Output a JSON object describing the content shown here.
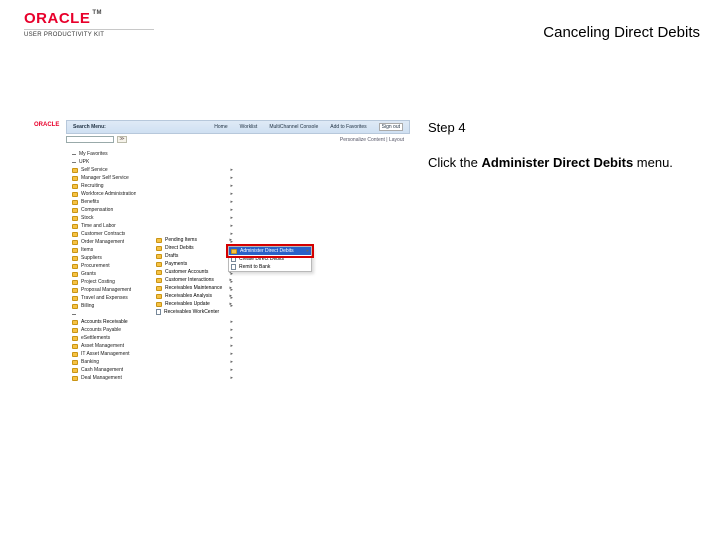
{
  "header": {
    "brand": "ORACLE",
    "brand_sub": "USER PRODUCTIVITY KIT",
    "tm": "TM",
    "topic_title": "Canceling Direct Debits"
  },
  "instructions": {
    "step_label": "Step 4",
    "line1": "Click the ",
    "bold_segment": "Administer Direct Debits",
    "line2": " menu."
  },
  "app": {
    "logo": "ORACLE",
    "search_label": "Search Menu:",
    "nav": [
      "Home",
      "Worklist",
      "MultiChannel Console",
      "Add to Favorites"
    ],
    "signout": "Sign out",
    "personalize": "Personalize Content | Layout"
  },
  "tree_left": [
    {
      "label": "My Favorites",
      "icon": "dash"
    },
    {
      "label": "UPK",
      "icon": "dash"
    },
    {
      "label": "Self Service",
      "icon": "folder",
      "arrow": true
    },
    {
      "label": "Manager Self Service",
      "icon": "folder",
      "arrow": true
    },
    {
      "label": "Recruiting",
      "icon": "folder",
      "arrow": true
    },
    {
      "label": "Workforce Administration",
      "icon": "folder",
      "arrow": true
    },
    {
      "label": "Benefits",
      "icon": "folder",
      "arrow": true
    },
    {
      "label": "Compensation",
      "icon": "folder",
      "arrow": true
    },
    {
      "label": "Stock",
      "icon": "folder",
      "arrow": true
    },
    {
      "label": "Time and Labor",
      "icon": "folder",
      "arrow": true
    },
    {
      "label": "Customer Contracts",
      "icon": "folder",
      "arrow": true
    },
    {
      "label": "Order Management",
      "icon": "folder",
      "arrow": true
    },
    {
      "label": "Items",
      "icon": "folder"
    },
    {
      "label": "Suppliers",
      "icon": "folder",
      "arrow": true
    },
    {
      "label": "Procurement",
      "icon": "folder",
      "arrow": true
    },
    {
      "label": "Grants",
      "icon": "folder",
      "arrow": true
    },
    {
      "label": "Project Costing",
      "icon": "folder",
      "arrow": true
    },
    {
      "label": "Proposal Management",
      "icon": "folder",
      "arrow": true
    },
    {
      "label": "Travel and Expenses",
      "icon": "folder",
      "arrow": true
    },
    {
      "label": "Billing",
      "icon": "folder",
      "arrow": true
    },
    {
      "label": "",
      "icon": "dash"
    },
    {
      "label": "Accounts Receivable",
      "icon": "folder",
      "arrow": true,
      "highlight": true
    },
    {
      "label": "Accounts Payable",
      "icon": "folder",
      "arrow": true
    },
    {
      "label": "eSettlements",
      "icon": "folder",
      "arrow": true
    },
    {
      "label": "Asset Management",
      "icon": "folder",
      "arrow": true
    },
    {
      "label": "IT Asset Management",
      "icon": "folder",
      "arrow": true
    },
    {
      "label": "Banking",
      "icon": "folder",
      "arrow": true
    },
    {
      "label": "Cash Management",
      "icon": "folder",
      "arrow": true
    },
    {
      "label": "Deal Management",
      "icon": "folder",
      "arrow": true
    }
  ],
  "tree_col2": [
    {
      "label": "Pending Items",
      "icon": "folder",
      "arrow": true
    },
    {
      "label": "Direct Debits",
      "icon": "folder",
      "arrow": true
    },
    {
      "label": "Drafts",
      "icon": "folder",
      "arrow": true
    },
    {
      "label": "Payments",
      "icon": "folder",
      "arrow": true
    },
    {
      "label": "Customer Accounts",
      "icon": "folder",
      "arrow": true
    },
    {
      "label": "Customer Interactions",
      "icon": "folder",
      "arrow": true
    },
    {
      "label": "Receivables Maintenance",
      "icon": "folder",
      "arrow": true
    },
    {
      "label": "Receivables Analysis",
      "icon": "folder",
      "arrow": true
    },
    {
      "label": "Receivables Update",
      "icon": "folder",
      "arrow": true
    },
    {
      "label": "Receivables WorkCenter",
      "icon": "page"
    }
  ],
  "submenu": [
    {
      "label": "Administer Direct Debits",
      "arrow": true,
      "selected": true,
      "icon": "folder"
    },
    {
      "label": "Create Direct Debits",
      "icon": "page"
    },
    {
      "label": "Remit to Bank",
      "icon": "page"
    }
  ]
}
